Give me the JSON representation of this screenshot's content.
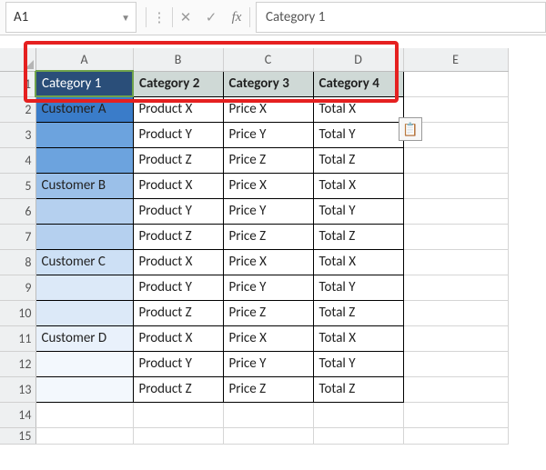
{
  "formula_bar": {
    "cell_ref": "A1",
    "value": "Category 1"
  },
  "columns": [
    "A",
    "B",
    "C",
    "D",
    "E"
  ],
  "row_numbers": [
    "1",
    "2",
    "3",
    "4",
    "5",
    "6",
    "7",
    "8",
    "9",
    "10",
    "11",
    "12",
    "13",
    "14",
    "15"
  ],
  "headers": {
    "A": "Category 1",
    "B": "Category 2",
    "C": "Category 3",
    "D": "Category 4"
  },
  "rows": [
    {
      "A": "Customer A",
      "B": "Product X",
      "C": "Price X",
      "D": "Total X"
    },
    {
      "A": "",
      "B": "Product Y",
      "C": "Price Y",
      "D": "Total Y"
    },
    {
      "A": "",
      "B": "Product Z",
      "C": "Price Z",
      "D": "Total Z"
    },
    {
      "A": "Customer B",
      "B": "Product X",
      "C": "Price X",
      "D": "Total X"
    },
    {
      "A": "",
      "B": "Product Y",
      "C": "Price Y",
      "D": "Total Y"
    },
    {
      "A": "",
      "B": "Product Z",
      "C": "Price Z",
      "D": "Total Z"
    },
    {
      "A": "Customer C",
      "B": "Product X",
      "C": "Price X",
      "D": "Total X"
    },
    {
      "A": "",
      "B": "Product Y",
      "C": "Price Y",
      "D": "Total Y"
    },
    {
      "A": "",
      "B": "Product Z",
      "C": "Price Z",
      "D": "Total Z"
    },
    {
      "A": "Customer D",
      "B": "Product X",
      "C": "Price X",
      "D": "Total X"
    },
    {
      "A": "",
      "B": "Product Y",
      "C": "Price Y",
      "D": "Total Y"
    },
    {
      "A": "",
      "B": "Product Z",
      "C": "Price Z",
      "D": "Total Z"
    }
  ],
  "chart_data": {
    "type": "table",
    "columns": [
      "Category 1",
      "Category 2",
      "Category 3",
      "Category 4"
    ],
    "data": [
      [
        "Customer A",
        "Product X",
        "Price X",
        "Total X"
      ],
      [
        "",
        "Product Y",
        "Price Y",
        "Total Y"
      ],
      [
        "",
        "Product Z",
        "Price Z",
        "Total Z"
      ],
      [
        "Customer B",
        "Product X",
        "Price X",
        "Total X"
      ],
      [
        "",
        "Product Y",
        "Price Y",
        "Total Y"
      ],
      [
        "",
        "Product Z",
        "Price Z",
        "Total Z"
      ],
      [
        "Customer C",
        "Product X",
        "Price X",
        "Total X"
      ],
      [
        "",
        "Product Y",
        "Price Y",
        "Total Y"
      ],
      [
        "",
        "Product Z",
        "Price Z",
        "Total Z"
      ],
      [
        "Customer D",
        "Product X",
        "Price X",
        "Total X"
      ],
      [
        "",
        "Product Y",
        "Price Y",
        "Total Y"
      ],
      [
        "",
        "Product Z",
        "Price Z",
        "Total Z"
      ]
    ]
  }
}
